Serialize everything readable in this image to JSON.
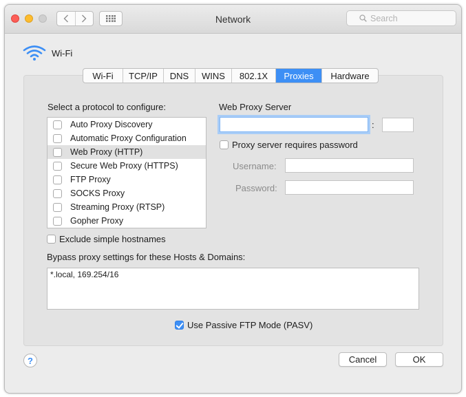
{
  "window": {
    "title": "Network"
  },
  "search": {
    "placeholder": "Search"
  },
  "service": {
    "name": "Wi-Fi"
  },
  "tabs": [
    {
      "label": "Wi-Fi",
      "selected": false
    },
    {
      "label": "TCP/IP",
      "selected": false
    },
    {
      "label": "DNS",
      "selected": false
    },
    {
      "label": "WINS",
      "selected": false
    },
    {
      "label": "802.1X",
      "selected": false
    },
    {
      "label": "Proxies",
      "selected": true
    },
    {
      "label": "Hardware",
      "selected": false
    }
  ],
  "protocols": {
    "heading": "Select a protocol to configure:",
    "items": [
      {
        "label": "Auto Proxy Discovery",
        "checked": false,
        "selected": false
      },
      {
        "label": "Automatic Proxy Configuration",
        "checked": false,
        "selected": false
      },
      {
        "label": "Web Proxy (HTTP)",
        "checked": false,
        "selected": true
      },
      {
        "label": "Secure Web Proxy (HTTPS)",
        "checked": false,
        "selected": false
      },
      {
        "label": "FTP Proxy",
        "checked": false,
        "selected": false
      },
      {
        "label": "SOCKS Proxy",
        "checked": false,
        "selected": false
      },
      {
        "label": "Streaming Proxy (RTSP)",
        "checked": false,
        "selected": false
      },
      {
        "label": "Gopher Proxy",
        "checked": false,
        "selected": false
      }
    ]
  },
  "proxy_server": {
    "heading": "Web Proxy Server",
    "host_value": "",
    "colon": ":",
    "port_value": "",
    "requires_password_label": "Proxy server requires password",
    "requires_password_checked": false,
    "username_label": "Username:",
    "username_value": "",
    "password_label": "Password:",
    "password_value": ""
  },
  "exclude_simple": {
    "label": "Exclude simple hostnames",
    "checked": false
  },
  "bypass": {
    "heading": "Bypass proxy settings for these Hosts & Domains:",
    "value": "*.local, 169.254/16"
  },
  "passive_ftp": {
    "label": "Use Passive FTP Mode (PASV)",
    "checked": true
  },
  "buttons": {
    "help": "?",
    "cancel": "Cancel",
    "ok": "OK"
  },
  "colors": {
    "accent": "#3d8ff5",
    "window_bg": "#ececec",
    "panel_bg": "#e3e3e3"
  },
  "icons": {
    "close": "close-icon",
    "minimize": "minimize-icon",
    "zoom": "zoom-icon",
    "back": "chevron-left-icon",
    "forward": "chevron-right-icon",
    "show_all": "grid-icon",
    "search": "magnifier-icon",
    "wifi": "wifi-icon"
  }
}
